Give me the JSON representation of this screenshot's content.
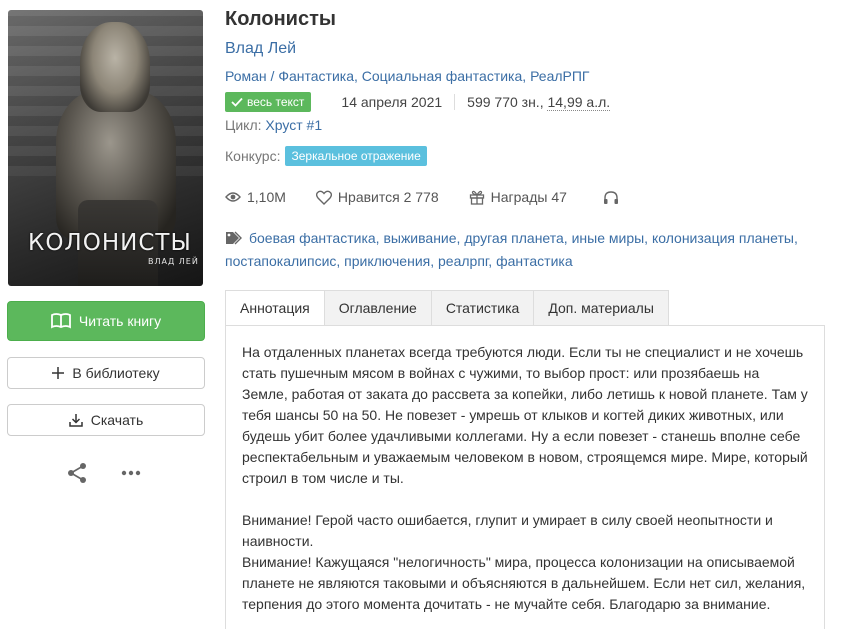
{
  "book": {
    "cover": {
      "title": "КОЛОНИСТЫ",
      "author": "ВЛАД ЛЕЙ"
    },
    "title": "Колонисты",
    "author": "Влад Лей",
    "genre_path": "Роман",
    "genres": [
      "Фантастика",
      "Социальная фантастика",
      "РеалРПГ"
    ],
    "full_text_badge": "весь текст",
    "date": "14 апреля 2021",
    "size_chars": "599 770 зн.,",
    "size_al": "14,99 а.л.",
    "cycle_label": "Цикл:",
    "cycle_name": "Хруст #1",
    "contest_label": "Конкурс:",
    "contest_name": "Зеркальное отражение"
  },
  "stats": {
    "views": "1,10M",
    "likes": "Нравится 2 778",
    "awards": "Награды 47"
  },
  "tags": [
    "боевая фантастика",
    "выживание",
    "другая планета",
    "иные миры",
    "колонизация планеты",
    "постапокалипсис",
    "приключения",
    "реалрпг",
    "фантастика"
  ],
  "actions": {
    "read": "Читать книгу",
    "library": "В библиотеку",
    "download": "Скачать"
  },
  "tabs": [
    "Аннотация",
    "Оглавление",
    "Статистика",
    "Доп. материалы"
  ],
  "annotation": {
    "p1": "На отдаленных планетах всегда требуются люди. Если ты не специалист и не хочешь стать пушечным мясом в войнах с чужими, то выбор прост: или прозябаешь на Земле, работая от заката до рассвета за копейки, либо летишь к новой планете. Там у тебя шансы 50 на 50. Не повезет - умрешь от клыков и когтей диких животных, или будешь убит более удачливыми коллегами. Ну а если повезет - станешь вполне себе респектабельным и уважаемым человеком в новом, строящемся мире. Мире, который строил в том числе и ты.",
    "p2": "Внимание! Герой часто ошибается, глупит и умирает в силу своей неопытности и наивности.",
    "p3": "Внимание! Кажущаяся \"нелогичность\" мира, процесса колонизации на описываемой планете не являются таковыми и объясняются в дальнейшем. Если нет сил, желания, терпения до этого момента дочитать - не мучайте себя. Благодарю за внимание."
  },
  "colors": {
    "link": "#3b6ea5",
    "success": "#5cb85c",
    "info": "#5bc0de"
  },
  "icons": [
    "book-open-icon",
    "plus-icon",
    "download-icon",
    "share-icon",
    "more-icon",
    "check-icon",
    "eye-icon",
    "heart-icon",
    "gift-icon",
    "headphones-icon",
    "tags-icon"
  ]
}
